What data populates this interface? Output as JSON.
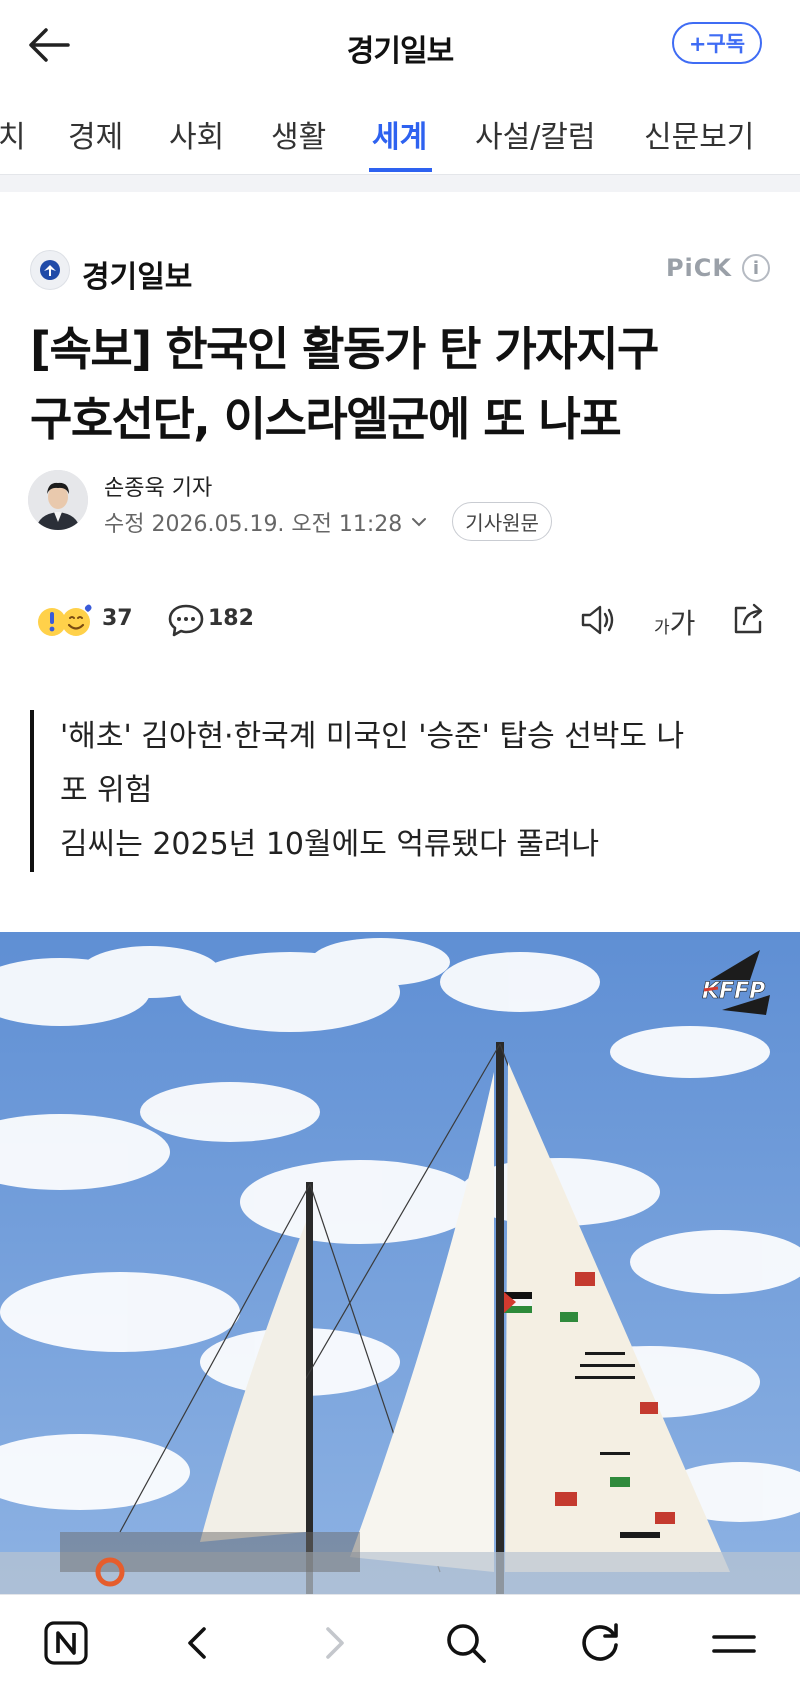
{
  "header": {
    "title": "경기일보",
    "subscribe_label": "+구독"
  },
  "tabs": [
    {
      "label": "치"
    },
    {
      "label": "경제"
    },
    {
      "label": "사회"
    },
    {
      "label": "생활"
    },
    {
      "label": "세계",
      "active": true
    },
    {
      "label": "사설/칼럼"
    },
    {
      "label": "신문보기"
    }
  ],
  "press": {
    "name": "경기일보",
    "pick_label": "PiCK",
    "info_glyph": "i"
  },
  "article": {
    "headline_line1": "[속보] 한국인 활동가 탄 가자지구",
    "headline_line2": "구호선단, 이스라엘군에 또 나포",
    "reporter": "손종욱 기자",
    "updated": "수정 2026.05.19. 오전 11:28",
    "origin_label": "기사원문",
    "summary_line1": "'해초' 김아현·한국계 미국인 '승준' 탑승 선박도 나",
    "summary_line2": "포 위험",
    "summary_line3": "김씨는 2025년 10월에도 억류됐다 풀려나"
  },
  "reactions": {
    "reaction_count": "37",
    "comment_count": "182",
    "font_small": "가",
    "font_large": "가"
  },
  "colors": {
    "accent": "#2e62f0",
    "subscribe": "#3f6cf4",
    "sky": "#6e9ad6"
  },
  "icons": [
    "back-arrow-icon",
    "info-icon",
    "emoji-reaction-icon",
    "comment-icon",
    "speaker-icon",
    "font-size-icon",
    "share-icon",
    "naver-n-icon",
    "chevron-left-icon",
    "chevron-right-icon",
    "search-icon",
    "refresh-icon",
    "menu-icon"
  ]
}
